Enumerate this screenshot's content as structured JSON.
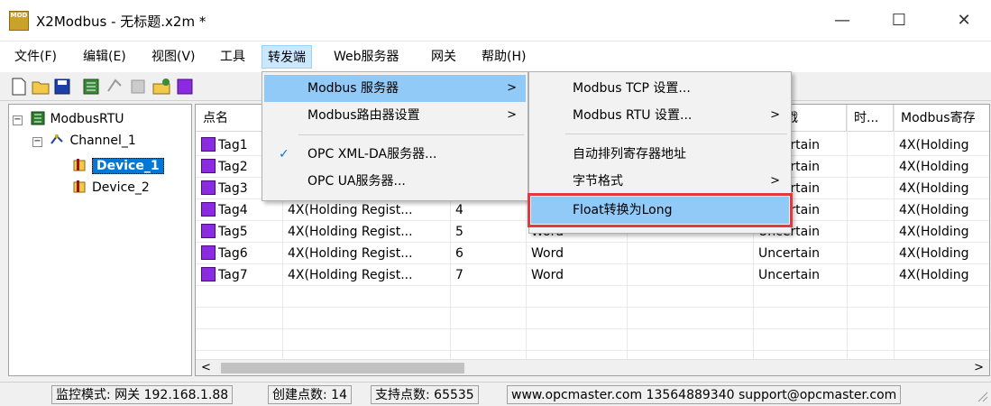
{
  "window": {
    "app_icon_text": "MOD",
    "title": "X2Modbus - 无标题.x2m *",
    "minimize": "—",
    "maximize": "☐",
    "close": "✕"
  },
  "menubar": {
    "items": [
      "文件(F)",
      "编辑(E)",
      "视图(V)",
      "工具",
      "转发端",
      "Web服务器",
      "网关",
      "帮助(H)"
    ]
  },
  "tree": {
    "root": "ModbusRTU",
    "channel": "Channel_1",
    "device1": "Device_1",
    "device2": "Device_2",
    "expand_symbol": "−"
  },
  "grid": {
    "headers": [
      "点名",
      "",
      "",
      "",
      "",
      "质量戳",
      "时...",
      "Modbus寄存"
    ],
    "rows": [
      {
        "name": "Tag1",
        "reg": "",
        "addr": "",
        "type": "",
        "quality": "Uncertain",
        "mreg": "4X(Holding"
      },
      {
        "name": "Tag2",
        "reg": "",
        "addr": "",
        "type": "",
        "quality": "Uncertain",
        "mreg": "4X(Holding"
      },
      {
        "name": "Tag3",
        "reg": "",
        "addr": "",
        "type": "",
        "quality": "Uncertain",
        "mreg": "4X(Holding"
      },
      {
        "name": "Tag4",
        "reg": "4X(Holding Regist...",
        "addr": "4",
        "type": "",
        "quality": "Uncertain",
        "mreg": "4X(Holding"
      },
      {
        "name": "Tag5",
        "reg": "4X(Holding Regist...",
        "addr": "5",
        "type": "Word",
        "quality": "Uncertain",
        "mreg": "4X(Holding"
      },
      {
        "name": "Tag6",
        "reg": "4X(Holding Regist...",
        "addr": "6",
        "type": "Word",
        "quality": "Uncertain",
        "mreg": "4X(Holding"
      },
      {
        "name": "Tag7",
        "reg": "4X(Holding Regist...",
        "addr": "7",
        "type": "Word",
        "quality": "Uncertain",
        "mreg": "4X(Holding"
      }
    ],
    "scroll_left": "<",
    "scroll_right": ">"
  },
  "menu_forward": {
    "items": [
      "Modbus 服务器",
      "Modbus路由器设置",
      "OPC XML-DA服务器...",
      "OPC UA服务器..."
    ],
    "check": "✓",
    "arrow": ">"
  },
  "menu_modbus_server": {
    "items": [
      "Modbus TCP 设置...",
      "Modbus RTU 设置...",
      "自动排列寄存器地址",
      "字节格式",
      "Float转换为Long"
    ],
    "arrow": ">"
  },
  "status": {
    "mode": "监控模式: 网关 192.168.1.88",
    "created": "创建点数: 14",
    "supported": "支持点数: 65535",
    "contact": "www.opcmaster.com 13564889340 support@opcmaster.com"
  },
  "colors": {
    "menu_highlight": "#91c9f7",
    "selection": "#0078d7",
    "highlight_box": "#e0393e"
  }
}
